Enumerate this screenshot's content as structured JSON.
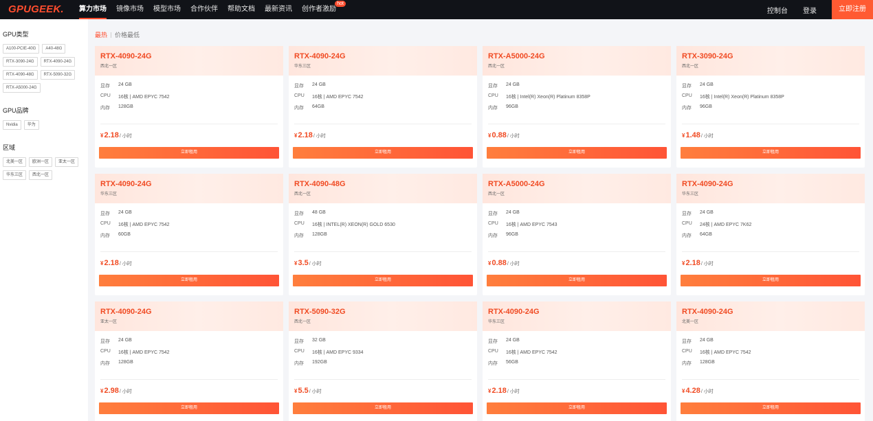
{
  "header": {
    "logo": "GPUGEEK",
    "logo_dot": ".",
    "nav": [
      {
        "label": "算力市场",
        "active": true
      },
      {
        "label": "镜像市场"
      },
      {
        "label": "模型市场"
      },
      {
        "label": "合作伙伴"
      },
      {
        "label": "帮助文档"
      },
      {
        "label": "最新资讯"
      },
      {
        "label": "创作者激励",
        "badge": "hot"
      }
    ],
    "console": "控制台",
    "login": "登录",
    "register": "立即注册"
  },
  "sidebar": {
    "gpu_type_title": "GPU类型",
    "gpu_types": [
      "A100-PCIE-40G",
      "A40-48G",
      "RTX-3090-24G",
      "RTX-4090-24G",
      "RTX-4090-48G",
      "RTX-5090-32G",
      "RTX-A5000-24G"
    ],
    "gpu_brand_title": "GPU品牌",
    "gpu_brands": [
      "Nvidia",
      "华为"
    ],
    "region_title": "区域",
    "regions": [
      "北美一区",
      "欧洲一区",
      "亚太一区",
      "华东三区",
      "西北一区"
    ]
  },
  "sort": {
    "hot": "最热",
    "lowest_price": "价格最低"
  },
  "spec_labels": {
    "vram": "显存",
    "cpu": "CPU",
    "ram": "内存"
  },
  "currency": "¥",
  "price_unit": "/ 小时",
  "rent_label": "立即租用",
  "cards": [
    {
      "title": "RTX-4090-24G",
      "region": "西北一区",
      "vram": "24 GB",
      "cpu": "16核 | AMD EPYC 7542",
      "ram": "128GB",
      "price": "2.18"
    },
    {
      "title": "RTX-4090-24G",
      "region": "华东三区",
      "vram": "24 GB",
      "cpu": "16核 | AMD EPYC 7542",
      "ram": "64GB",
      "price": "2.18"
    },
    {
      "title": "RTX-A5000-24G",
      "region": "西北一区",
      "vram": "24 GB",
      "cpu": "16核 | Intel(R) Xeon(R) Platinum 8358P",
      "ram": "96GB",
      "price": "0.88"
    },
    {
      "title": "RTX-3090-24G",
      "region": "西北一区",
      "vram": "24 GB",
      "cpu": "16核 | Intel(R) Xeon(R) Platinum 8358P",
      "ram": "96GB",
      "price": "1.48"
    },
    {
      "title": "RTX-4090-24G",
      "region": "华东三区",
      "vram": "24 GB",
      "cpu": "16核 | AMD EPYC 7542",
      "ram": "60GB",
      "price": "2.18"
    },
    {
      "title": "RTX-4090-48G",
      "region": "西北一区",
      "vram": "48 GB",
      "cpu": "16核 | INTEL(R) XEON(R) GOLD 6530",
      "ram": "128GB",
      "price": "3.5"
    },
    {
      "title": "RTX-A5000-24G",
      "region": "西北一区",
      "vram": "24 GB",
      "cpu": "16核 | AMD EPYC 7543",
      "ram": "96GB",
      "price": "0.88"
    },
    {
      "title": "RTX-4090-24G",
      "region": "华东三区",
      "vram": "24 GB",
      "cpu": "24核 | AMD EPYC 7K62",
      "ram": "64GB",
      "price": "2.18"
    },
    {
      "title": "RTX-4090-24G",
      "region": "亚太一区",
      "vram": "24 GB",
      "cpu": "16核 | AMD EPYC 7542",
      "ram": "128GB",
      "price": "2.98"
    },
    {
      "title": "RTX-5090-32G",
      "region": "西北一区",
      "vram": "32 GB",
      "cpu": "16核 | AMD EPYC 9334",
      "ram": "192GB",
      "price": "5.5"
    },
    {
      "title": "RTX-4090-24G",
      "region": "华东三区",
      "vram": "24 GB",
      "cpu": "16核 | AMD EPYC 7542",
      "ram": "56GB",
      "price": "2.18"
    },
    {
      "title": "RTX-4090-24G",
      "region": "北美一区",
      "vram": "24 GB",
      "cpu": "16核 | AMD EPYC 7542",
      "ram": "128GB",
      "price": "4.28"
    }
  ]
}
